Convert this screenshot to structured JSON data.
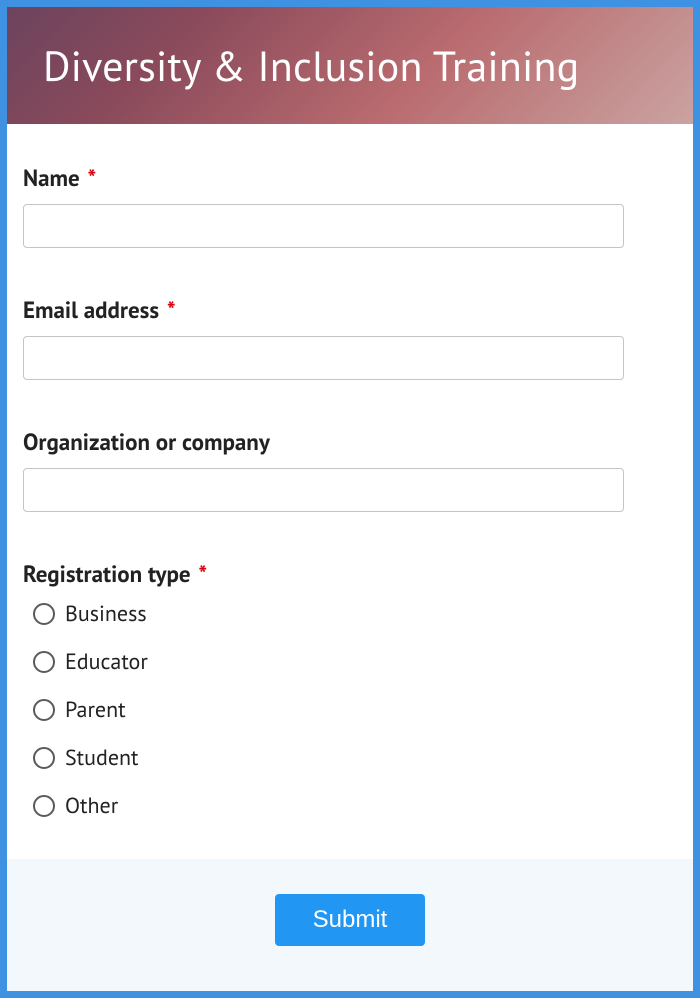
{
  "header": {
    "title": "Diversity & Inclusion Training"
  },
  "fields": {
    "name_label": "Name",
    "name_required": "*",
    "email_label": "Email address",
    "email_required": "*",
    "org_label": "Organization or company",
    "regtype_label": "Registration type",
    "regtype_required": "*",
    "regtype_options": {
      "opt0": "Business",
      "opt1": "Educator",
      "opt2": "Parent",
      "opt3": "Student",
      "opt4": "Other"
    }
  },
  "footer": {
    "submit_label": "Submit"
  }
}
